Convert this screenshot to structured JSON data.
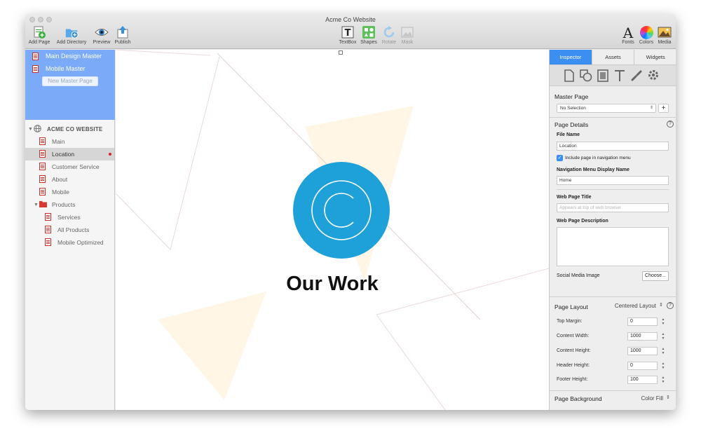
{
  "window": {
    "title": "Acme Co Website"
  },
  "toolbar": {
    "left": [
      {
        "label": "Add Page",
        "icon": "add-page-icon"
      },
      {
        "label": "Add Directory",
        "icon": "add-directory-icon"
      },
      {
        "label": "Preview",
        "icon": "preview-eye-icon"
      },
      {
        "label": "Publish",
        "icon": "publish-icon"
      }
    ],
    "center": [
      {
        "label": "TextBox",
        "icon": "textbox-icon"
      },
      {
        "label": "Shapes",
        "icon": "shapes-icon"
      },
      {
        "label": "Rotate",
        "icon": "rotate-icon"
      },
      {
        "label": "Mask",
        "icon": "mask-icon"
      }
    ],
    "right": [
      {
        "label": "Fonts",
        "icon": "fonts-icon"
      },
      {
        "label": "Colors",
        "icon": "colors-icon"
      },
      {
        "label": "Media",
        "icon": "media-icon"
      }
    ]
  },
  "sidebar": {
    "masters": [
      {
        "label": "Main Design Master"
      },
      {
        "label": "Mobile Master"
      }
    ],
    "new_master_label": "New Master Page",
    "site_name": "ACME CO WEBSITE",
    "pages": [
      {
        "label": "Main"
      },
      {
        "label": "Location"
      },
      {
        "label": "Customer Service"
      },
      {
        "label": "About"
      },
      {
        "label": "Mobile"
      },
      {
        "label": "Products"
      },
      {
        "label": "Services"
      },
      {
        "label": "All Products"
      },
      {
        "label": "Mobile Optimized"
      }
    ]
  },
  "canvas": {
    "heading": "Our Work",
    "logo_color": "#1ea0d8"
  },
  "inspector": {
    "tabs": [
      "Inspector",
      "Assets",
      "Widgets"
    ],
    "master_page": {
      "title": "Master Page",
      "selected": "No Selection",
      "add_label": "+"
    },
    "page_details": {
      "title": "Page Details",
      "help": "?",
      "file_name_label": "File Name",
      "file_name_value": "Location",
      "include_nav_label": "Include page in navigation menu",
      "nav_display_label": "Navigation Menu Display Name",
      "nav_display_value": "Home",
      "web_title_label": "Web Page Title",
      "web_title_placeholder": "Appears at top of web browser",
      "web_desc_label": "Web Page Description",
      "social_label": "Social Media Image",
      "choose_label": "Choose..."
    },
    "page_layout": {
      "title": "Page Layout",
      "mode": "Centered Layout",
      "help": "?",
      "rows": [
        {
          "label": "Top Margin:",
          "value": "0"
        },
        {
          "label": "Content Width:",
          "value": "1000"
        },
        {
          "label": "Content Height:",
          "value": "1000"
        },
        {
          "label": "Header Height:",
          "value": "0"
        },
        {
          "label": "Footer Height:",
          "value": "100"
        }
      ]
    },
    "page_background": {
      "title": "Page Background",
      "mode": "Color Fill"
    }
  }
}
